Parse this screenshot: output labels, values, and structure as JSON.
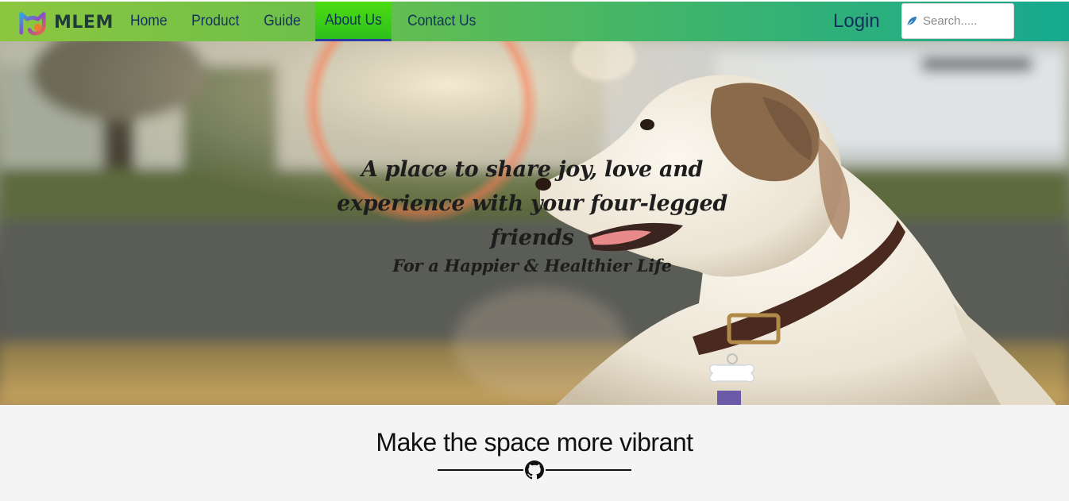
{
  "brand": {
    "name": "MLEM",
    "logo_icon": "cat-logo-icon"
  },
  "nav": {
    "items": [
      {
        "label": "Home",
        "active": false
      },
      {
        "label": "Product",
        "active": false
      },
      {
        "label": "Guide",
        "active": false
      },
      {
        "label": "About Us",
        "active": true
      },
      {
        "label": "Contact Us",
        "active": false
      }
    ],
    "login_label": "Login",
    "search": {
      "placeholder": "Search.....",
      "value": "",
      "icon": "feather-icon"
    }
  },
  "hero": {
    "title": "A place to share joy, love and experience with your four-legged friends",
    "subtitle": "For a Happier & Healthier Life",
    "image": "dog-photo"
  },
  "section": {
    "title": "Make the space more vibrant",
    "divider_icon": "github-icon"
  },
  "colors": {
    "nav_gradient_start": "#8cc63f",
    "nav_gradient_end": "#16a98f",
    "nav_text": "#13305c",
    "active_tab": "#3dd017",
    "active_underline": "#2e3aa8",
    "section_bg": "#f4f4f4"
  }
}
